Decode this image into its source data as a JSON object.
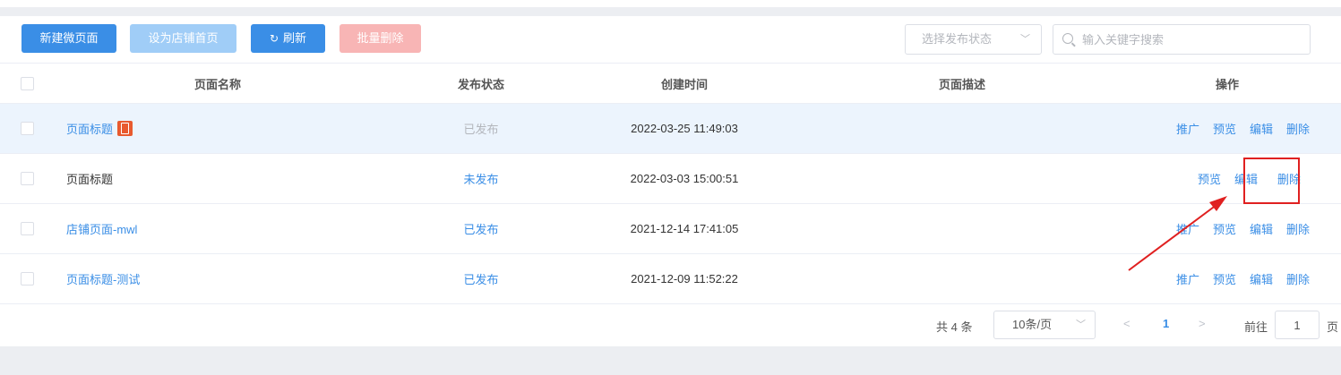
{
  "toolbar": {
    "new_label": "新建微页面",
    "set_home_label": "设为店铺首页",
    "refresh_label": "刷新",
    "batch_delete_label": "批量删除",
    "status_select_placeholder": "选择发布状态",
    "search_placeholder": "输入关键字搜索"
  },
  "table": {
    "headers": {
      "name": "页面名称",
      "status": "发布状态",
      "time": "创建时间",
      "desc": "页面描述",
      "ops": "操作"
    },
    "rows": [
      {
        "name": "页面标题",
        "status": "已发布",
        "time": "2022-03-25 11:49:03",
        "ops": [
          "推广",
          "预览",
          "编辑",
          "删除"
        ]
      },
      {
        "name": "页面标题",
        "status": "未发布",
        "time": "2022-03-03 15:00:51",
        "ops": [
          "预览",
          "编辑",
          "删除"
        ]
      },
      {
        "name": "店铺页面-mwl",
        "status": "已发布",
        "time": "2021-12-14 17:41:05",
        "ops": [
          "推广",
          "预览",
          "编辑",
          "删除"
        ]
      },
      {
        "name": "页面标题-测试",
        "status": "已发布",
        "time": "2021-12-09 11:52:22",
        "ops": [
          "推广",
          "预览",
          "编辑",
          "删除"
        ]
      }
    ]
  },
  "pagination": {
    "total": "共 4 条",
    "page_size": "10条/页",
    "current_page": "1",
    "goto_label": "前往",
    "goto_value": "1",
    "page_unit": "页"
  },
  "icons": {
    "refresh": "refresh-icon",
    "dropdown": "chevron-down-icon",
    "search": "search-icon",
    "mobile": "mobile-page-icon",
    "prev": "chevron-left-icon",
    "next": "chevron-right-icon"
  },
  "colors": {
    "primary": "#3a8ee6",
    "primary_disabled": "#a0cdf7",
    "danger_disabled": "#f8b5b5",
    "highlight_row": "#ecf4fd",
    "annotation": "#e02020",
    "mobile_icon": "#e85a2f"
  }
}
